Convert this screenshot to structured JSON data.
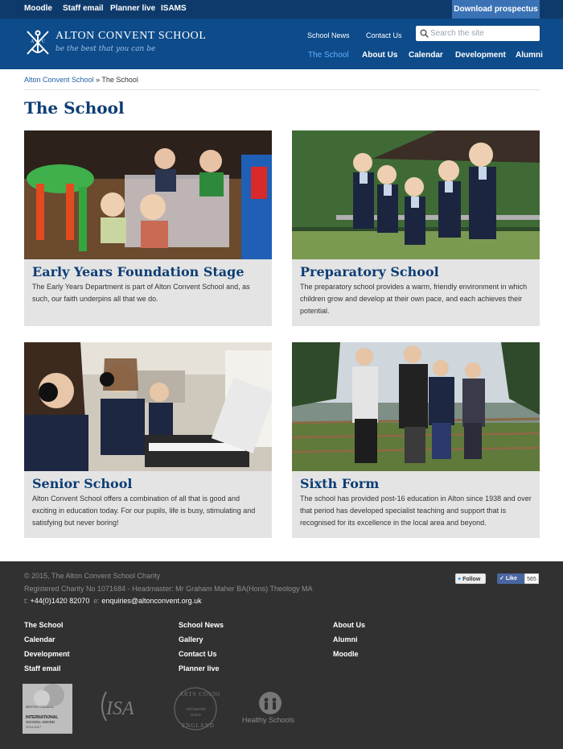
{
  "topbar": {
    "links": [
      "Moodle",
      "Staff email",
      "Planner live",
      "ISAMS"
    ],
    "prospectus": "Download prospectus"
  },
  "header": {
    "school_name": "ALTON CONVENT SCHOOL",
    "tagline": "be the best that you can be",
    "secondary_links": [
      "School News",
      "Contact Us"
    ],
    "search_placeholder": "Search the site",
    "nav": [
      "The School",
      "About Us",
      "Calendar",
      "Development",
      "Alumni"
    ],
    "active_nav": "The School"
  },
  "breadcrumb": {
    "home": "Alton Convent School",
    "separator": " » ",
    "current": "The School"
  },
  "page_title": "The School",
  "cards": [
    {
      "title": "Early Years Foundation Stage",
      "text": "The Early Years Department is part of Alton Convent School and, as such, our faith underpins all that we do."
    },
    {
      "title": "Preparatory School",
      "text": "The preparatory school provides a warm, friendly environment in which children grow and develop at their own pace, and each achieves their potential."
    },
    {
      "title": "Senior School",
      "text": "Alton Convent School offers a combination of all that is good and exciting in education today. For our pupils, life is busy, stimulating and satisfying but never boring!"
    },
    {
      "title": "Sixth Form",
      "text": "The school has provided post-16 education in Alton since 1938 and over that period has developed specialist teaching and support that is recognised for its excellence in the local area and beyond."
    }
  ],
  "footer": {
    "copyright": "© 2015, The Alton Convent School Charity",
    "registered": "Registered Charity No 1071684 - Headmaster: Mr Graham Maher BA(Hons) Theology MA",
    "tel_label": "t: ",
    "tel": "+44(0)1420 82070",
    "email_label": "e: ",
    "email": "enquiries@altonconvent.org.uk",
    "twitter_label": "Follow",
    "facebook_label": "Like",
    "facebook_count": "565",
    "columns": [
      [
        "The School",
        "Calendar",
        "Development",
        "Staff email"
      ],
      [
        "School News",
        "Gallery",
        "Contact Us",
        "Planner live"
      ],
      [
        "About Us",
        "Alumni",
        "Moodle"
      ]
    ],
    "logos": {
      "award_top": "BRITISH COUNCIL",
      "award_main": "INTERNATIONAL SCHOOL AWARD",
      "award_years": "2014-2017",
      "isa": "ISA",
      "arts_top": "ARTS COUNCIL",
      "arts_mid": "ARTSMARK",
      "arts_gold": "GOLD",
      "arts_bottom": "ENGLAND",
      "healthy": "Healthy Schools"
    }
  },
  "colors": {
    "topbar": "#0e3a6b",
    "header": "#0d4b8a",
    "prospectus": "#3a72b5",
    "title": "#0d3d75",
    "card_bg": "#e4e4e4",
    "footer": "#313131"
  }
}
